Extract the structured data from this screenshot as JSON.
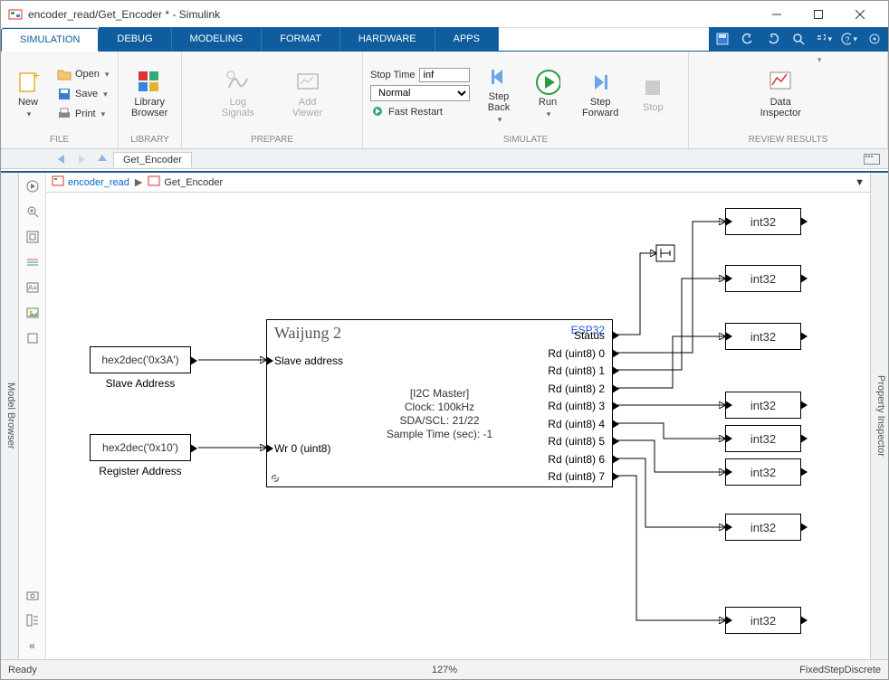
{
  "window": {
    "title": "encoder_read/Get_Encoder * - Simulink"
  },
  "tabs": {
    "active": "SIMULATION",
    "items": [
      "SIMULATION",
      "DEBUG",
      "MODELING",
      "FORMAT",
      "HARDWARE",
      "APPS"
    ]
  },
  "ribbon": {
    "file": {
      "label": "FILE",
      "new": "New",
      "open": "Open",
      "save": "Save",
      "print": "Print"
    },
    "library": {
      "label": "LIBRARY",
      "browser": "Library\nBrowser"
    },
    "prepare": {
      "label": "PREPARE",
      "log": "Log\nSignals",
      "viewer": "Add\nViewer"
    },
    "simulate": {
      "label": "SIMULATE",
      "stoptime_lbl": "Stop Time",
      "stoptime_val": "inf",
      "mode": "Normal",
      "fastrestart": "Fast Restart",
      "stepback": "Step\nBack",
      "run": "Run",
      "stepfwd": "Step\nForward",
      "stop": "Stop"
    },
    "review": {
      "label": "REVIEW RESULTS",
      "di": "Data\nInspector"
    }
  },
  "nav": {
    "doctab": "Get_Encoder",
    "root": "encoder_read",
    "sub": "Get_Encoder"
  },
  "sidebars": {
    "left": "Model Browser",
    "right": "Property Inspector"
  },
  "blocks": {
    "const1": {
      "text": "hex2dec('0x3A')",
      "label": "Slave Address"
    },
    "const2": {
      "text": "hex2dec('0x10')",
      "label": "Register Address"
    },
    "main": {
      "title": "Waijung 2",
      "chip": "ESP32",
      "in1": "Slave address",
      "in2": "Wr 0 (uint8)",
      "status": "Status",
      "outs": [
        "Rd (uint8) 0",
        "Rd (uint8) 1",
        "Rd (uint8) 2",
        "Rd (uint8) 3",
        "Rd (uint8) 4",
        "Rd (uint8) 5",
        "Rd (uint8) 6",
        "Rd (uint8) 7"
      ],
      "center": [
        "[I2C Master]",
        "Clock: 100kHz",
        "SDA/SCL: 21/22",
        "Sample Time (sec): -1"
      ]
    },
    "conv": "int32"
  },
  "status": {
    "ready": "Ready",
    "zoom": "127%",
    "solver": "FixedStepDiscrete"
  }
}
